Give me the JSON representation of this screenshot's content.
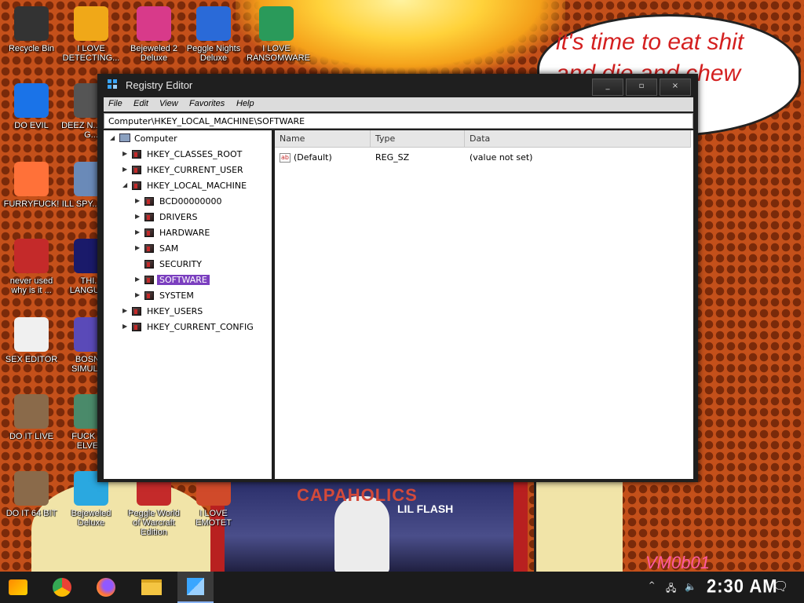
{
  "wallpaper": {
    "bubble_line1": "it's time to eat shit",
    "bubble_line2": "and die and chew",
    "bubble_tail": "w",
    "poster_title": "CAPAHOLICS",
    "poster_sub": "LIL FLASH",
    "watermark": "VM0b01"
  },
  "desktop_icons": [
    {
      "label": "Recycle Bin",
      "icon": "recycle-bin-icon",
      "color": "#333333"
    },
    {
      "label": "I LOVE DETECTING...",
      "icon": "de-app-icon",
      "color": "#f0a818"
    },
    {
      "label": "Bejeweled 2 Deluxe",
      "icon": "bejeweled2-icon",
      "color": "#d83a8a"
    },
    {
      "label": "Peggle Nights Deluxe",
      "icon": "peggle-nights-icon",
      "color": "#2a6ad8"
    },
    {
      "label": "I LOVE RANSOMWARE",
      "icon": "project-icon",
      "color": "#2a9a5a"
    },
    {
      "label": "DO EVIL",
      "icon": "chrome-icon",
      "color": "#1a73e8"
    },
    {
      "label": "DEEZ N... HAH G...",
      "icon": "folder-icon",
      "color": "#555555"
    },
    {
      "label": "FURRYFUCK!",
      "icon": "firefox-icon",
      "color": "#ff7139"
    },
    {
      "label": "ILL SPY... YOU",
      "icon": "magnifier-icon",
      "color": "#6a8ab8"
    },
    {
      "label": "never used why is it ...",
      "icon": "devcpp-icon",
      "color": "#c42a2a"
    },
    {
      "label": "THI... LANGUA...",
      "icon": "go-icon",
      "color": "#1a1a6a"
    },
    {
      "label": "SEX EDITOR",
      "icon": "hxd-icon",
      "color": "#f0f0f0"
    },
    {
      "label": "BOSN... SIMULA...",
      "icon": "virus-icon",
      "color": "#5a4ab8"
    },
    {
      "label": "DO IT LIVE",
      "icon": "portrait-icon",
      "color": "#8a6a4a"
    },
    {
      "label": "FUCK S... ELVE...",
      "icon": "game-icon",
      "color": "#4a8a6a"
    },
    {
      "label": "DO IT 64 BIT",
      "icon": "portrait64-icon",
      "color": "#8a6a4a"
    },
    {
      "label": "Bejeweled Deluxe",
      "icon": "bejeweled-icon",
      "color": "#2aa8e0"
    },
    {
      "label": "Peggle World of Warcraft Edition",
      "icon": "peggle-wow-icon",
      "color": "#c42a2a"
    },
    {
      "label": "I LOVE EMOTET",
      "icon": "powerpoint-icon",
      "color": "#d04a2a"
    }
  ],
  "window": {
    "title": "Registry Editor",
    "minimize": "_",
    "maximize": "▫",
    "close": "×",
    "menu": [
      "File",
      "Edit",
      "View",
      "Favorites",
      "Help"
    ],
    "address": "Computer\\HKEY_LOCAL_MACHINE\\SOFTWARE",
    "tree": {
      "root": "Computer",
      "hives": [
        "HKEY_CLASSES_ROOT",
        "HKEY_CURRENT_USER",
        "HKEY_LOCAL_MACHINE",
        "HKEY_USERS",
        "HKEY_CURRENT_CONFIG"
      ],
      "hklm_children": [
        "BCD00000000",
        "DRIVERS",
        "HARDWARE",
        "SAM",
        "SECURITY",
        "SOFTWARE",
        "SYSTEM"
      ],
      "selected": "SOFTWARE"
    },
    "columns": [
      "Name",
      "Type",
      "Data"
    ],
    "values": [
      {
        "name": "(Default)",
        "type": "REG_SZ",
        "data": "(value not set)"
      }
    ]
  },
  "taskbar": {
    "apps": [
      "start-icon",
      "chrome-icon",
      "firefox-icon",
      "file-explorer-icon",
      "registry-editor-icon"
    ],
    "active": "registry-editor-icon",
    "clock": "2:30 AM",
    "tray_chevron": "^",
    "network": "network-icon",
    "volume": "volume-icon",
    "notifications": "notification-icon"
  }
}
